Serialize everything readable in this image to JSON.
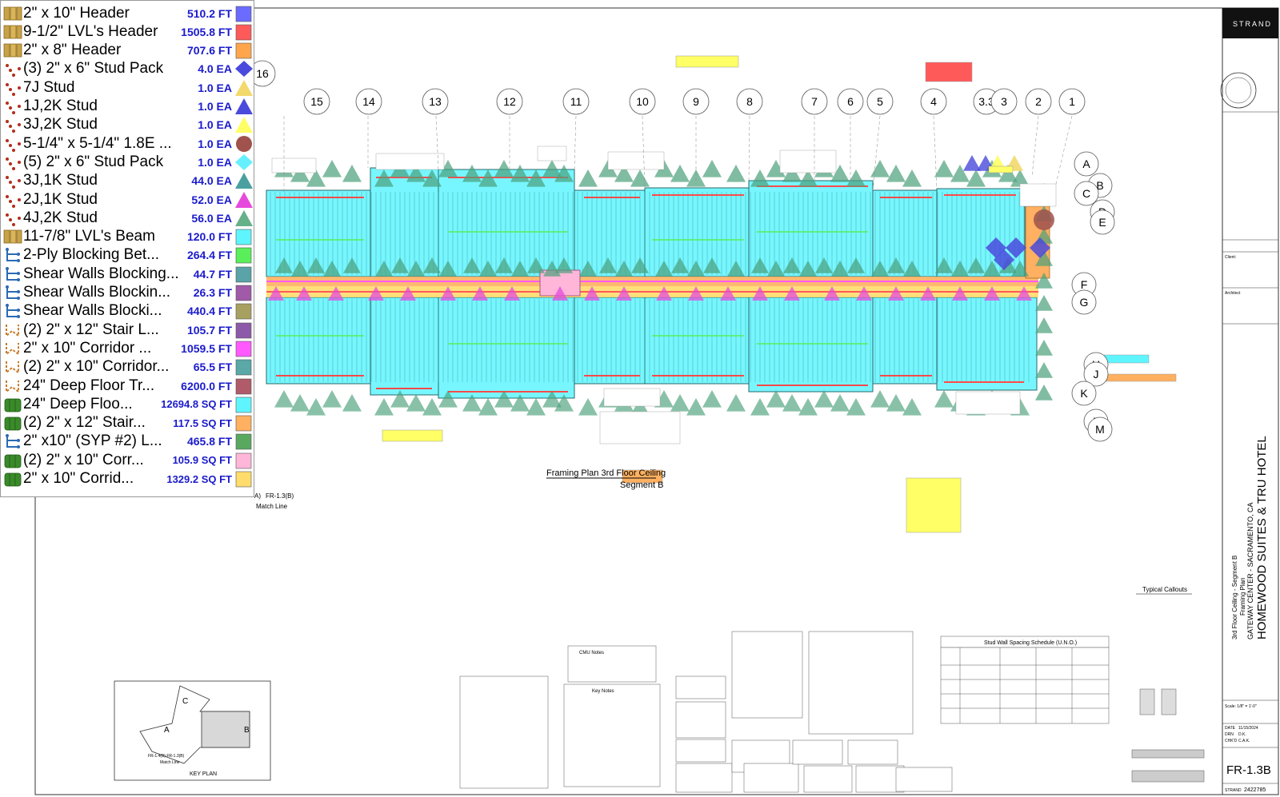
{
  "legend": [
    {
      "icon": "folder-icon",
      "name": "2\" x 10\" Header",
      "qty": "510.2 FT",
      "symbol": "square",
      "color": "#6b6bff"
    },
    {
      "icon": "folder-icon",
      "name": "9-1/2\" LVL's Header",
      "qty": "1505.8 FT",
      "symbol": "square",
      "color": "#ff5a5a"
    },
    {
      "icon": "folder-icon",
      "name": "2\" x 8\" Header",
      "qty": "707.6 FT",
      "symbol": "square",
      "color": "#ffa64d"
    },
    {
      "icon": "dots-icon",
      "name": "(3) 2\" x 6\" Stud Pack",
      "qty": "4.0 EA",
      "symbol": "diamond",
      "color": "#4a4adc"
    },
    {
      "icon": "dots-icon",
      "name": "7J Stud",
      "qty": "1.0 EA",
      "symbol": "triangle",
      "color": "#f3d86b"
    },
    {
      "icon": "dots-icon",
      "name": "1J,2K Stud",
      "qty": "1.0 EA",
      "symbol": "triangle",
      "color": "#4a4adc"
    },
    {
      "icon": "dots-icon",
      "name": "3J,2K Stud",
      "qty": "1.0 EA",
      "symbol": "triangle",
      "color": "#ffff66"
    },
    {
      "icon": "dots-icon",
      "name": "5-1/4\" x 5-1/4\" 1.8E ...",
      "qty": "1.0 EA",
      "symbol": "circle",
      "color": "#a0524d"
    },
    {
      "icon": "dots-icon",
      "name": "(5) 2\" x 6\" Stud Pack",
      "qty": "1.0 EA",
      "symbol": "diamond",
      "color": "#66f0ff"
    },
    {
      "icon": "dots-icon",
      "name": "3J,1K Stud",
      "qty": "44.0 EA",
      "symbol": "triangle",
      "color": "#4aa0a0"
    },
    {
      "icon": "dots-icon",
      "name": "2J,1K Stud",
      "qty": "52.0 EA",
      "symbol": "triangle",
      "color": "#e64adc"
    },
    {
      "icon": "dots-icon",
      "name": "4J,2K Stud",
      "qty": "56.0 EA",
      "symbol": "triangle",
      "color": "#66b08a"
    },
    {
      "icon": "folder-icon",
      "name": "11-7/8\" LVL's Beam",
      "qty": "120.0 FT",
      "symbol": "square",
      "color": "#5ff5ff"
    },
    {
      "icon": "path-icon",
      "name": "2-Ply Blocking Bet...",
      "qty": "264.4 FT",
      "symbol": "square",
      "color": "#5aee5a"
    },
    {
      "icon": "path-icon",
      "name": "Shear Walls Blocking...",
      "qty": "44.7 FT",
      "symbol": "square",
      "color": "#5aa3a8"
    },
    {
      "icon": "path-icon",
      "name": "Shear Walls Blockin...",
      "qty": "26.3 FT",
      "symbol": "square",
      "color": "#a05aa8"
    },
    {
      "icon": "path-icon",
      "name": "Shear Walls Blocki...",
      "qty": "440.4 FT",
      "symbol": "square",
      "color": "#a8a060"
    },
    {
      "icon": "path-orange-icon",
      "name": "(2) 2\" x 12\" Stair L...",
      "qty": "105.7 FT",
      "symbol": "square",
      "color": "#8c5aa8"
    },
    {
      "icon": "path-orange-icon",
      "name": "2\" x 10\" Corridor ...",
      "qty": "1059.5 FT",
      "symbol": "square",
      "color": "#ff5aff"
    },
    {
      "icon": "path-orange-icon",
      "name": "(2) 2\" x 10\" Corridor...",
      "qty": "65.5 FT",
      "symbol": "square",
      "color": "#5aa8a8"
    },
    {
      "icon": "path-orange-icon",
      "name": "24\" Deep Floor Tr...",
      "qty": "6200.0 FT",
      "symbol": "square",
      "color": "#b05a6a"
    },
    {
      "icon": "area-icon",
      "name": "24\" Deep Floo...",
      "qty": "12694.8 SQ FT",
      "symbol": "square",
      "color": "#5ff5ff"
    },
    {
      "icon": "area-icon",
      "name": "(2) 2\" x 12\" Stair...",
      "qty": "117.5 SQ FT",
      "symbol": "square",
      "color": "#ffb060"
    },
    {
      "icon": "path-icon",
      "name": "2\" x10\" (SYP #2) L...",
      "qty": "465.8 FT",
      "symbol": "square",
      "color": "#5aa860"
    },
    {
      "icon": "area-icon",
      "name": "(2) 2\" x 10\" Corr...",
      "qty": "105.9 SQ FT",
      "symbol": "square",
      "color": "#ffb6d9"
    },
    {
      "icon": "area-icon",
      "name": "2\" x 10\" Corrid...",
      "qty": "1329.2 SQ FT",
      "symbol": "square",
      "color": "#ffdc6b"
    }
  ],
  "grid_lines_top": [
    "16",
    "15",
    "14",
    "13",
    "12",
    "11",
    "10",
    "9",
    "8",
    "7",
    "6",
    "5",
    "4",
    "3.3",
    "3",
    "2",
    "1"
  ],
  "grid_lines_right": [
    "A",
    "B",
    "C",
    "D",
    "E",
    "F",
    "G",
    "H",
    "J",
    "K",
    "L",
    "M"
  ],
  "drawing_title": {
    "label": "Framing Plan   3rd Floor Ceiling",
    "sub": "Segment B"
  },
  "match_line": {
    "ref": "FR-1.3(B)",
    "label": "Match Line",
    "key": "A)"
  },
  "key_plan": {
    "label": "KEY PLAN",
    "zones": [
      "A",
      "B",
      "C"
    ],
    "ref": "FR-1.4(B)  FR-1.3(B)",
    "match": "Match Line"
  },
  "notes_headers": {
    "cmu": "CMU Notes",
    "key": "Key Notes",
    "typical": "Typical Callouts",
    "stud_wall": "Stud Wall Spacing Schedule (U.N.O.)"
  },
  "title_block": {
    "firm": "STRAND",
    "project": "HOMEWOOD SUITES & TRU HOTEL",
    "location": "GATEWAY CENTER - SACRAMENTO, CA",
    "sheet_desc1": "Framing Plan",
    "sheet_desc2": "3rd Floor Ceiling - Segment B",
    "scale": "Scale: 1/8\" = 1'-0\"",
    "date_label": "DATE",
    "date": "11/15/2024",
    "drn_label": "DRN",
    "drn": "D.K.",
    "chkd_label": "CHK'D",
    "chkd": "C.A.K.",
    "sheet_no": "FR-1.3B",
    "strand_no_label": "STRAND",
    "strand_no": "2422785",
    "client_label": "Client:",
    "architect_label": "Architect"
  }
}
